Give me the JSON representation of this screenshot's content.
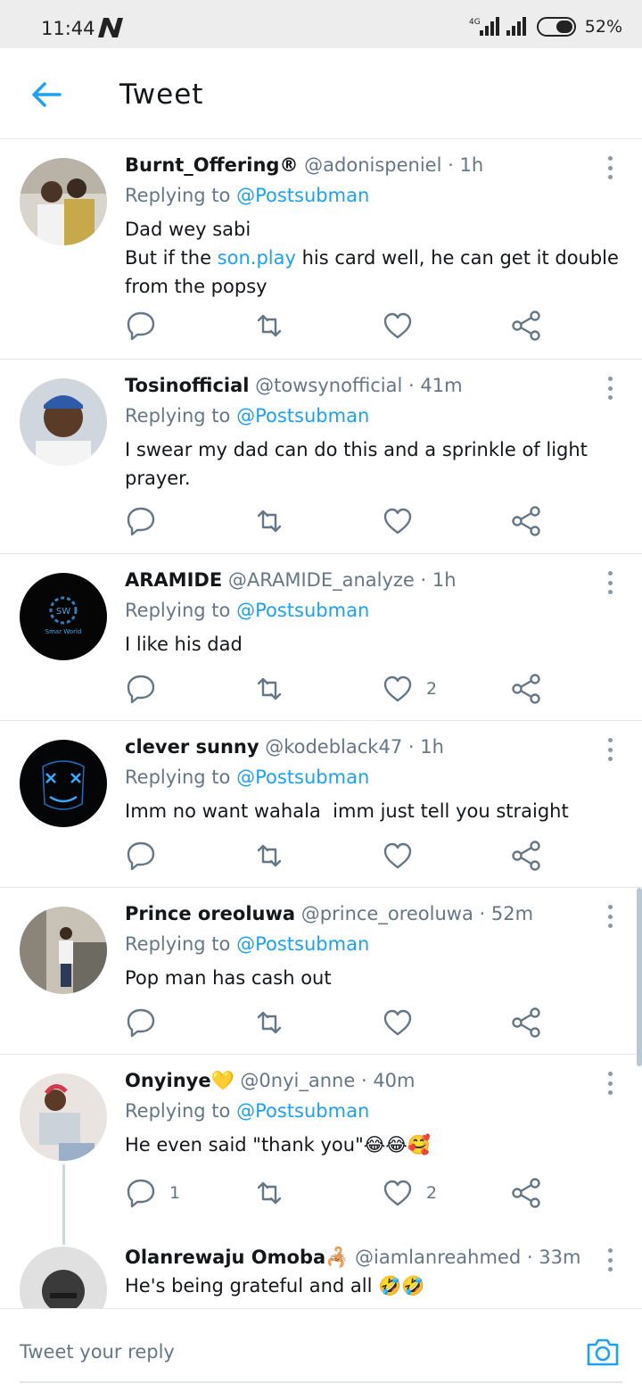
{
  "status": {
    "time": "11:44",
    "battery": "52%",
    "network": "4G"
  },
  "header": {
    "title": "Tweet"
  },
  "tweets": [
    {
      "name": "Burnt_Offering®",
      "handle": "@adonispeniel",
      "time": "1h",
      "reply_prefix": "Replying to",
      "reply_to": "@Postsubman",
      "text_line1": "Dad wey sabi",
      "text_pre": "But if the ",
      "text_link": "son.play",
      "text_post": " his card well, he can get it double from the popsy",
      "reply_count": "",
      "like_count": ""
    },
    {
      "name": "Tosinofficial",
      "handle": "@towsynofficial",
      "time": "41m",
      "reply_prefix": "Replying to",
      "reply_to": "@Postsubman",
      "text": "I swear my dad can do this and a sprinkle of light prayer.",
      "reply_count": "",
      "like_count": ""
    },
    {
      "name": "ARAMIDE",
      "handle": "@ARAMIDE_analyze",
      "time": "1h",
      "reply_prefix": "Replying to",
      "reply_to": "@Postsubman",
      "text": "I like his dad",
      "reply_count": "",
      "like_count": "2",
      "avatar_text": "Smar World"
    },
    {
      "name": "clever sunny",
      "handle": "@kodeblack47",
      "time": "1h",
      "reply_prefix": "Replying to",
      "reply_to": "@Postsubman",
      "text": "Imm no want wahala  imm just tell you straight",
      "reply_count": "",
      "like_count": ""
    },
    {
      "name": "Prince oreoluwa",
      "handle": "@prince_oreoluwa",
      "time": "52m",
      "reply_prefix": "Replying to",
      "reply_to": "@Postsubman",
      "text": "Pop man has cash out",
      "reply_count": "",
      "like_count": ""
    },
    {
      "name": "Onyinye💛",
      "handle": "@0nyi_anne",
      "time": "40m",
      "reply_prefix": "Replying to",
      "reply_to": "@Postsubman",
      "text": "He even said \"thank you\"😂😂🥰",
      "reply_count": "1",
      "like_count": "2"
    },
    {
      "name": "Olanrewaju Omoba🦂",
      "handle": "@iamlanreahmed",
      "time": "33m",
      "text": "He's being grateful and all 🤣🤣"
    }
  ],
  "footer": {
    "placeholder": "Tweet your reply"
  },
  "colors": {
    "accent": "#1da1f2",
    "muted": "#657786",
    "divider": "#e3e6e8"
  },
  "icons": [
    "back-arrow-icon",
    "more-vertical-icon",
    "reply-icon",
    "retweet-icon",
    "like-icon",
    "share-icon",
    "camera-icon"
  ]
}
